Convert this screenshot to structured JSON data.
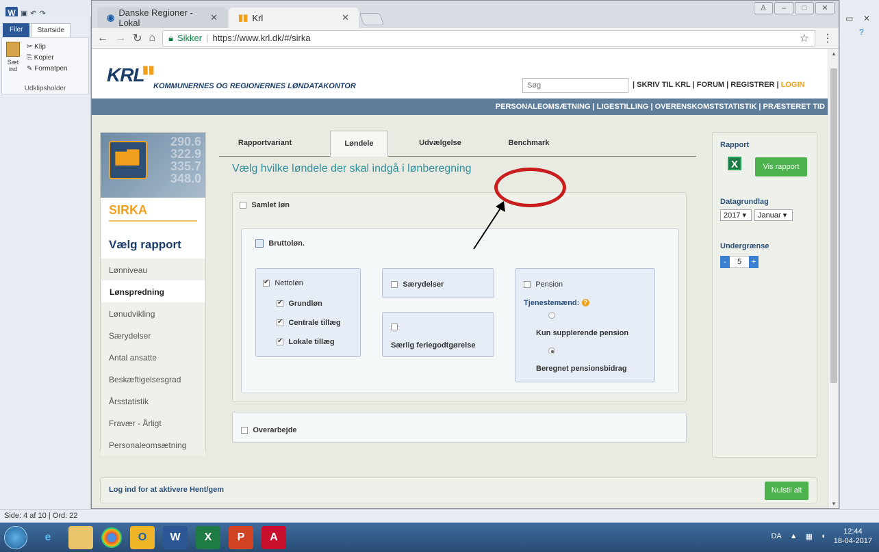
{
  "word": {
    "file_tab": "Filer",
    "home_tab": "Startside",
    "clip_items": [
      "Klip",
      "Kopier",
      "Formatpen"
    ],
    "paste_label": "Sæt ind",
    "clipboard_group": "Udklipsholder",
    "status_page": "Side: 4 af 10",
    "status_words": "Ord: 22"
  },
  "browser": {
    "tabs": [
      {
        "label": "Danske Regioner - Lokal"
      },
      {
        "label": "Krl"
      }
    ],
    "secure_label": "Sikker",
    "url": "https://www.krl.dk/#/sirka"
  },
  "site": {
    "logo": "KRL",
    "org_name": "KOMMUNERNES OG REGIONERNES LØNDATAKONTOR",
    "search_placeholder": "Søg",
    "toplinks": "| SKRIV TIL KRL | FORUM | REGISTRER |",
    "login": "LOGIN",
    "navbar": "PERSONALEOMSÆTNING | LIGESTILLING | OVERENSKOMSTSTATISTIK | PRÆSTERET TID"
  },
  "sidebar": {
    "bg_numbers": [
      "290.6",
      "322.9",
      "335.7",
      "348.0"
    ],
    "title": "SIRKA",
    "subtitle": "Vælg rapport",
    "items": [
      {
        "label": "Lønniveau"
      },
      {
        "label": "Lønspredning"
      },
      {
        "label": "Lønudvikling"
      },
      {
        "label": "Særydelser"
      },
      {
        "label": "Antal ansatte"
      },
      {
        "label": "Beskæftigelsesgrad"
      },
      {
        "label": "Årsstatistik"
      },
      {
        "label": "Fravær - Årligt"
      },
      {
        "label": "Personaleomsætning"
      }
    ],
    "active_index": 1
  },
  "tabs": [
    {
      "label": "Rapportvariant"
    },
    {
      "label": "Løndele"
    },
    {
      "label": "Udvælgelse"
    },
    {
      "label": "Benchmark"
    }
  ],
  "main": {
    "heading": "Vælg hvilke løndele der skal indgå i lønberegning",
    "samlet_lon": "Samlet løn",
    "bruttolon": "Bruttoløn.",
    "nettolon": "Nettoløn",
    "grundlon": "Grundløn",
    "centrale": "Centrale tillæg",
    "lokale": "Lokale tillæg",
    "saerydelser": "Særydelser",
    "ferie": "Særlig feriegodtgørelse",
    "pension": "Pension",
    "tjenestemaend": "Tjenestemænd:",
    "kun_suppl": "Kun supplerende pension",
    "beregnet": "Beregnet pensionsbidrag",
    "overarbejde": "Overarbejde"
  },
  "right": {
    "rapport": "Rapport",
    "vis_rapport": "Vis rapport",
    "datagrundlag": "Datagrundlag",
    "year": "2017 ▾",
    "month": "Januar ▾",
    "undergraense": "Undergrænse",
    "minus": "-",
    "value": "5",
    "plus": "+"
  },
  "footer": {
    "login_text": "Log ind for at aktivere Hent/gem",
    "reset": "Nulstil alt"
  },
  "taskbar": {
    "lang": "DA",
    "time": "12:44",
    "date": "18-04-2017"
  },
  "colors": {
    "accent_orange": "#f0a01c",
    "brand_blue": "#1b3d6a",
    "heading_teal": "#2f8f9a",
    "green_button": "#4db24d",
    "annotation_red": "#c81e1e"
  }
}
